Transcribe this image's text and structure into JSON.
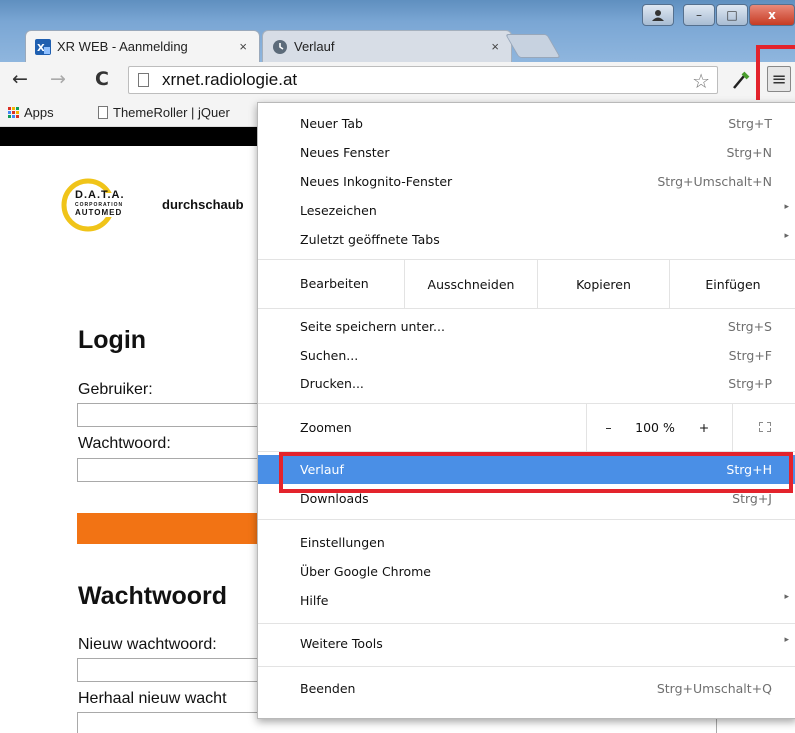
{
  "tabs": [
    {
      "title": "XR WEB - Aanmelding",
      "close": "×",
      "active": true
    },
    {
      "title": "Verlauf",
      "close": "×",
      "active": false
    }
  ],
  "window_controls": {
    "minimize": "–",
    "maximize": "□",
    "close": "x"
  },
  "toolbar": {
    "back": "←",
    "forward": "→",
    "reload": "C",
    "url": "xrnet.radiologie.at",
    "star": "☆",
    "menu": "≡",
    "dropper": "⁄"
  },
  "bookmarks": [
    {
      "label": "Apps"
    },
    {
      "label": "ThemeRoller | jQuer"
    }
  ],
  "page": {
    "logo_lines": [
      "D.A.T.A.",
      "CORPORATION",
      "AUTOMED"
    ],
    "tagline": "durchschaub",
    "login_heading": "Login",
    "user_label": "Gebruiker:",
    "password_label": "Wachtwoord:",
    "change_heading": "Wachtwoord",
    "new_password_label": "Nieuw wachtwoord:",
    "repeat_password_label": "Herhaal nieuw wacht"
  },
  "menu": {
    "group1": [
      {
        "label": "Neuer Tab",
        "shortcut": "Strg+T"
      },
      {
        "label": "Neues Fenster",
        "shortcut": "Strg+N"
      },
      {
        "label": "Neues Inkognito-Fenster",
        "shortcut": "Strg+Umschalt+N"
      },
      {
        "label": "Lesezeichen",
        "arrow": "▸"
      },
      {
        "label": "Zuletzt geöffnete Tabs",
        "arrow": "▸"
      }
    ],
    "edit": {
      "label": "Bearbeiten",
      "buttons": [
        "Ausschneiden",
        "Kopieren",
        "Einfügen"
      ]
    },
    "group2": [
      {
        "label": "Seite speichern unter...",
        "shortcut": "Strg+S"
      },
      {
        "label": "Suchen...",
        "shortcut": "Strg+F"
      },
      {
        "label": "Drucken...",
        "shortcut": "Strg+P"
      }
    ],
    "zoom": {
      "label": "Zoomen",
      "minus": "–",
      "value": "100 %",
      "plus": "+"
    },
    "group3": [
      {
        "label": "Verlauf",
        "shortcut": "Strg+H",
        "selected": true
      },
      {
        "label": "Downloads",
        "shortcut": "Strg+J"
      }
    ],
    "group4": [
      {
        "label": "Einstellungen"
      },
      {
        "label": "Über Google Chrome"
      },
      {
        "label": "Hilfe",
        "arrow": "▸"
      }
    ],
    "group5": [
      {
        "label": "Weitere Tools",
        "arrow": "▸"
      }
    ],
    "group6": [
      {
        "label": "Beenden",
        "shortcut": "Strg+Umschalt+Q"
      }
    ]
  },
  "colors": {
    "highlight": "#e3232c",
    "selected_row": "#4a8fe6",
    "orange_button": "#f27314",
    "apps_icon": [
      "#d93025",
      "#f4b400",
      "#0f9d58",
      "#4285f4"
    ]
  }
}
